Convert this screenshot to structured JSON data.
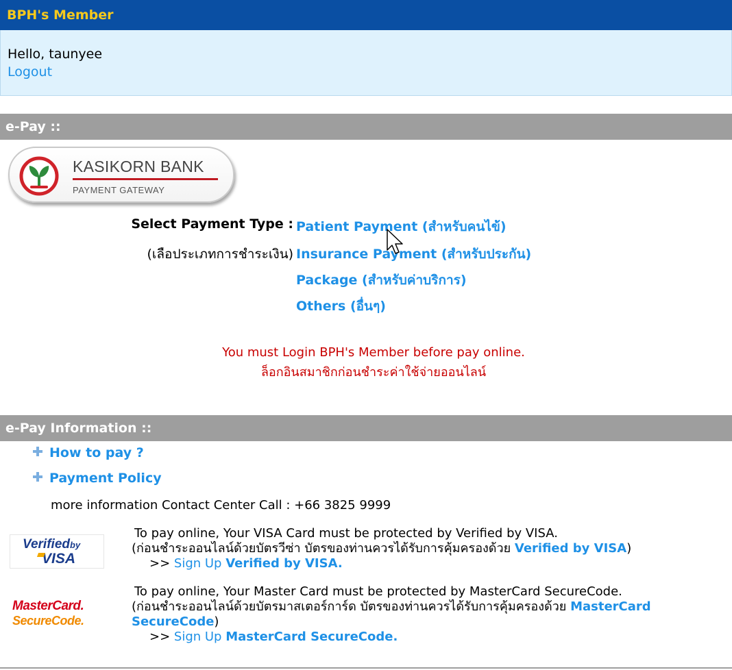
{
  "member": {
    "header": "BPH's Member",
    "greeting": "Hello, taunyee",
    "logout": "Logout"
  },
  "epay": {
    "section_title": "e-Pay ::",
    "bank_logo": {
      "name": "KASIKORN BANK",
      "subtitle": "PAYMENT GATEWAY"
    },
    "select_label": "Select Payment Type :",
    "select_label_thai": "(เลือประเภทการชำระเงิน)",
    "payment_types": [
      "Patient Payment (สำหรับคนไข้)",
      "Insurance Payment (สำหรับประกัน)",
      "Package (สำหรับค่าบริการ)",
      "Others (อื่นๆ)"
    ],
    "warning_en": "You must Login BPH's Member before pay online.",
    "warning_th": "ล็อกอินสมาชิกก่อนชำระค่าใช้จ่ายออนไลน์"
  },
  "info": {
    "section_title": "e-Pay Information ::",
    "how_to_pay": "How to pay ?",
    "payment_policy": "Payment Policy",
    "contact": "more information Contact Center Call : +66 3825 9999"
  },
  "visa": {
    "logo_line1": "Verified",
    "logo_by": "by",
    "logo_line2": "VISA",
    "line1": "To pay online, Your VISA Card must be protected by Verified by VISA.",
    "line2_prefix": "(ก่อนชำระออนไลน์ด้วยบัตรวีซ่า บัตรของท่านควรได้รับการคุ้มครองด้วย ",
    "line2_link": "Verified by VISA",
    "line2_suffix": ")",
    "signup_prefix": ">> ",
    "signup_link": "Sign Up",
    "signup_bold": "Verified by VISA."
  },
  "mastercard": {
    "logo_line1": "MasterCard.",
    "logo_line2": "SecureCode.",
    "line1": "To pay online, Your Master Card must be protected by MasterCard SecureCode.",
    "line2_prefix": "(ก่อนชำระออนไลน์ด้วยบัตรมาสเตอร์การ์ด บัตรของท่านควรได้รับการคุ้มครองด้วย ",
    "line2_link_a": "MasterCard",
    "line3_link_b": "SecureCode",
    "line3_suffix": ")",
    "signup_prefix": ">> ",
    "signup_link": "Sign Up",
    "signup_bold": "MasterCard SecureCode."
  },
  "colors": {
    "header_bg": "#0a4fa3",
    "header_text": "#f7c91c",
    "member_bg": "#dff2fd",
    "section_bar": "#9e9e9e",
    "link": "#1e90e6",
    "warning": "#c80000"
  },
  "icons": [
    "kasikorn-logo-icon",
    "plus-icon",
    "mouse-cursor-icon"
  ]
}
